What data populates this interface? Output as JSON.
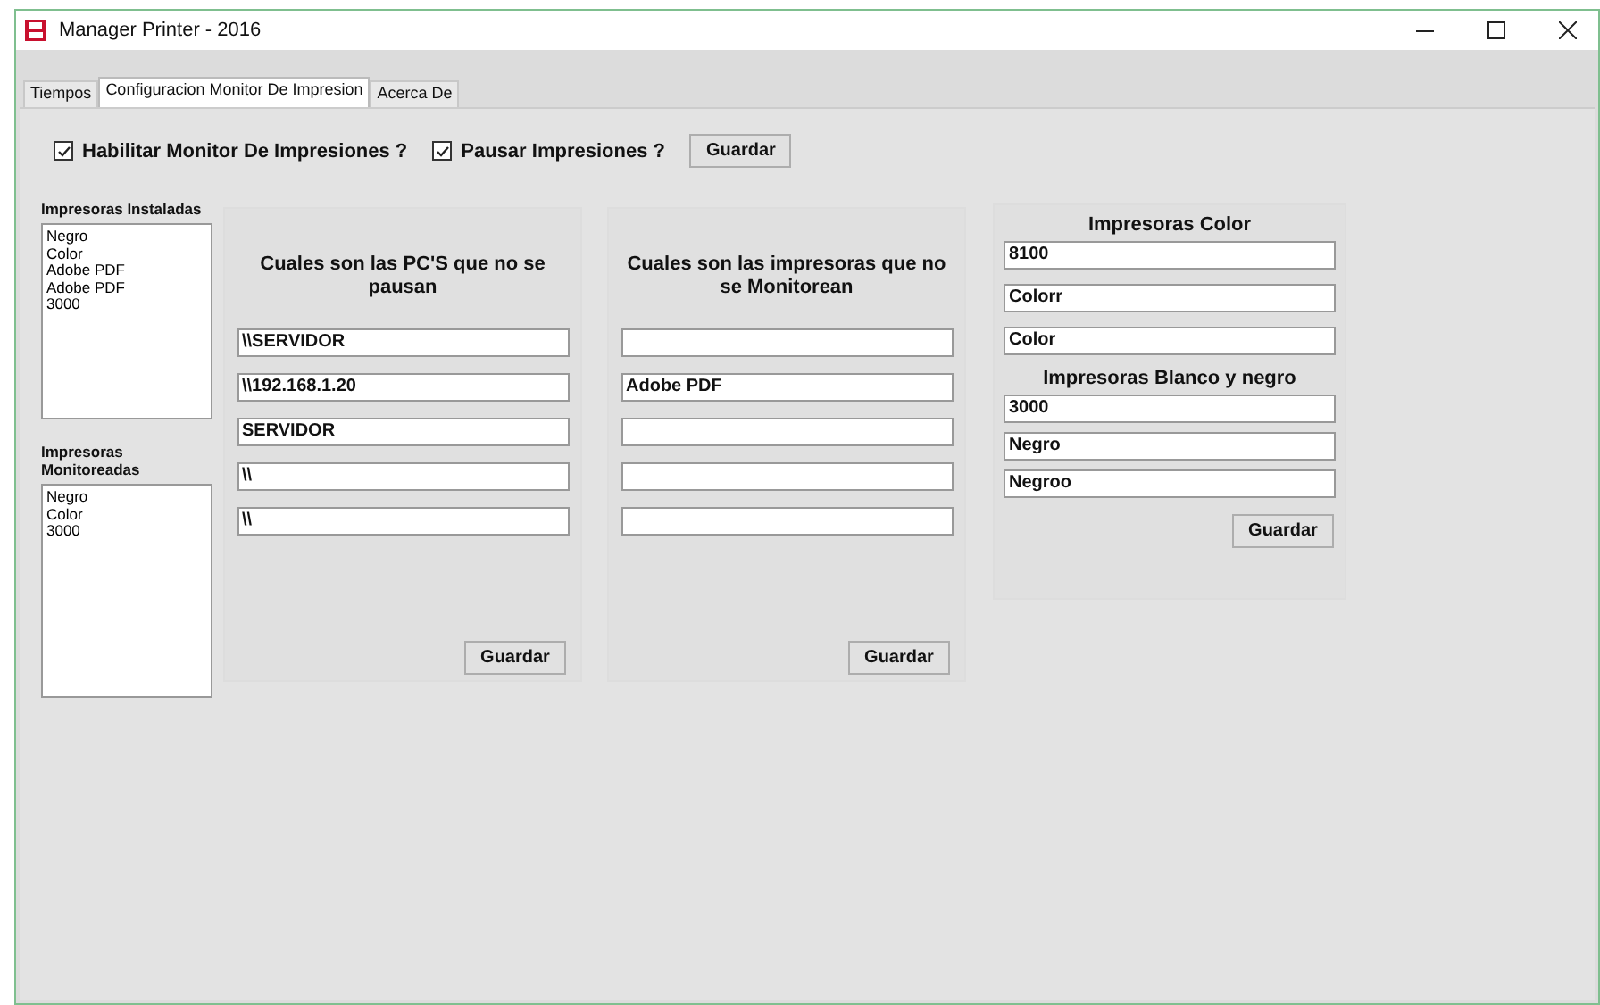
{
  "window": {
    "title": "Manager Printer - 2016"
  },
  "tabs": [
    {
      "label": "Tiempos",
      "selected": false
    },
    {
      "label": "Configuracion Monitor De Impresion",
      "selected": true
    },
    {
      "label": "Acerca De",
      "selected": false
    }
  ],
  "options": {
    "checkboxes": [
      {
        "label": "Habilitar Monitor De Impresiones ?",
        "checked": true
      },
      {
        "label": "Pausar Impresiones ?",
        "checked": true
      }
    ],
    "button": "Guardar"
  },
  "installed_printers": {
    "label": "Impresoras Instaladas",
    "items": [
      "Negro",
      "Color",
      "Adobe PDF",
      "Adobe PDF",
      "3000"
    ]
  },
  "monitored_printers": {
    "label": "Impresoras Monitoreadas",
    "items": [
      "Negro",
      "Color",
      "3000"
    ]
  },
  "unpaused_pcs": {
    "title": "Cuales son  las PC'S que no se pausan",
    "fields": [
      {
        "value": "\\\\SERVIDOR"
      },
      {
        "value": "\\\\192.168.1.20"
      },
      {
        "value": "SERVIDOR"
      },
      {
        "value": "\\\\"
      },
      {
        "value": "\\\\"
      }
    ],
    "button": "Guardar"
  },
  "unmonitored_printers": {
    "title": "Cuales son las impresoras que no se Monitorean",
    "fields": [
      {
        "kind": "blank"
      },
      {
        "kind": "text",
        "value": "Adobe PDF"
      },
      {
        "kind": "blank"
      },
      {
        "kind": "blank"
      },
      {
        "kind": "blank"
      }
    ],
    "button": "Guardar"
  },
  "printer_types": {
    "color_title": "Impresoras Color",
    "color_fields": [
      {
        "value": "8100"
      },
      {
        "value": "Colorr"
      },
      {
        "value": "Color"
      }
    ],
    "bw_title": "Impresoras Blanco y negro",
    "bw_fields": [
      {
        "value": "3000"
      },
      {
        "value": "Negro"
      },
      {
        "value": "Negroo"
      }
    ],
    "button": "Guardar"
  }
}
